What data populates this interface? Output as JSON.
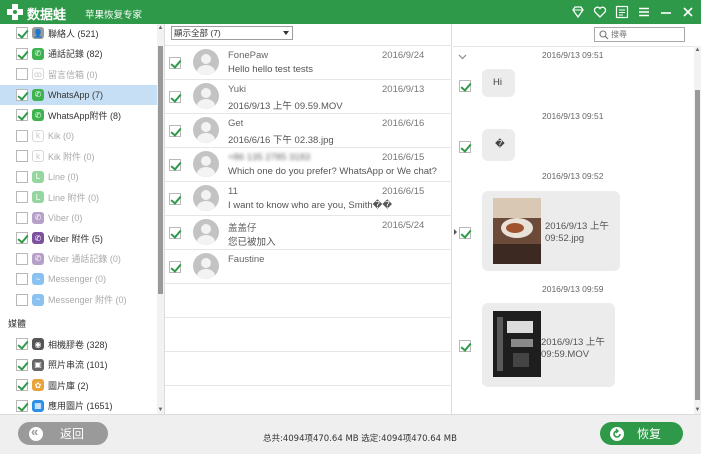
{
  "titlebar": {
    "app_name": "数据蛙",
    "subtitle": "苹果恢复专家",
    "accent_color": "#2e9948",
    "icons": [
      "gem-icon",
      "heart-icon",
      "feedback-icon",
      "menu-icon",
      "minimize-icon",
      "close-icon"
    ]
  },
  "sidebar": {
    "items": [
      {
        "label": "聯絡人 (521)",
        "checked": true,
        "icon": "contacts-icon",
        "dim": false
      },
      {
        "label": "通話記錄 (82)",
        "checked": true,
        "icon": "phone-icon",
        "dim": false
      },
      {
        "label": "留言信箱 (0)",
        "checked": false,
        "icon": "voicemail-icon",
        "dim": true
      },
      {
        "label": "WhatsApp (7)",
        "checked": true,
        "icon": "whatsapp-icon",
        "dim": false,
        "selected": true
      },
      {
        "label": "WhatsApp附件 (8)",
        "checked": true,
        "icon": "whatsapp-attachment-icon",
        "dim": false
      },
      {
        "label": "Kik (0)",
        "checked": false,
        "icon": "kik-icon",
        "dim": true
      },
      {
        "label": "Kik 附件 (0)",
        "checked": false,
        "icon": "kik-attachment-icon",
        "dim": true
      },
      {
        "label": "Line (0)",
        "checked": false,
        "icon": "line-icon",
        "dim": true
      },
      {
        "label": "Line 附件 (0)",
        "checked": false,
        "icon": "line-attachment-icon",
        "dim": true
      },
      {
        "label": "Viber (0)",
        "checked": false,
        "icon": "viber-icon",
        "dim": true
      },
      {
        "label": "Viber 附件 (5)",
        "checked": true,
        "icon": "viber-attachment-icon",
        "dim": false
      },
      {
        "label": "Viber 通話記錄 (0)",
        "checked": false,
        "icon": "viber-call-icon",
        "dim": true
      },
      {
        "label": "Messenger (0)",
        "checked": false,
        "icon": "messenger-icon",
        "dim": true
      },
      {
        "label": "Messenger 附件 (0)",
        "checked": false,
        "icon": "messenger-attachment-icon",
        "dim": true
      }
    ],
    "media_section": "媒體",
    "media_items": [
      {
        "label": "相機膠卷 (328)",
        "checked": true,
        "icon": "camera-icon"
      },
      {
        "label": "照片串流 (101)",
        "checked": true,
        "icon": "photostream-icon"
      },
      {
        "label": "圖片庫 (2)",
        "checked": true,
        "icon": "photo-library-icon"
      },
      {
        "label": "應用圖片 (1651)",
        "checked": true,
        "icon": "app-photos-icon"
      }
    ]
  },
  "list": {
    "filter_value": "顯示全部 (7)",
    "rows": [
      {
        "name": "FonePaw",
        "text": "Hello hello test tests",
        "date": "2016/9/24",
        "checked": true,
        "blurred_name": false
      },
      {
        "name": "Yuki",
        "text": "2016/9/13 上午 09.59.MOV",
        "date": "2016/9/13",
        "checked": true,
        "blurred_name": false
      },
      {
        "name": "Get",
        "text": "2016/6/16 下午 02.38.jpg",
        "date": "2016/6/16",
        "checked": true,
        "blurred_name": false
      },
      {
        "name": "+86 135 2785 3183",
        "text": "Which one do you prefer? WhatsApp or We chat?",
        "date": "2016/6/15",
        "checked": true,
        "blurred_name": true
      },
      {
        "name": "11",
        "text": "I want to know who are you, Smith��",
        "date": "2016/6/15",
        "checked": true,
        "blurred_name": false
      },
      {
        "name": "盖盖仔",
        "text": "您已被加入",
        "date": "2016/5/24",
        "checked": true,
        "blurred_name": false
      },
      {
        "name": "Faustine",
        "text": "",
        "date": "",
        "checked": true,
        "blurred_name": false
      }
    ]
  },
  "conversation": {
    "search_placeholder": "搜尋",
    "messages": [
      {
        "time": "2016/9/13 09:51",
        "text": "Hi",
        "checked": true
      },
      {
        "time": "2016/9/13 09:51",
        "text": "�",
        "checked": true
      },
      {
        "time": "2016/9/13 09:52",
        "caption": "2016/9/13 上午 09:52.jpg",
        "checked": true
      },
      {
        "time": "2016/9/13 09:59",
        "caption": "2016/9/13 上午 09:59.MOV",
        "checked": true
      }
    ]
  },
  "footer": {
    "back_label": "返回",
    "status": "总共:4094项470.64 MB 选定:4094项470.64 MB",
    "restore_label": "恢复"
  }
}
